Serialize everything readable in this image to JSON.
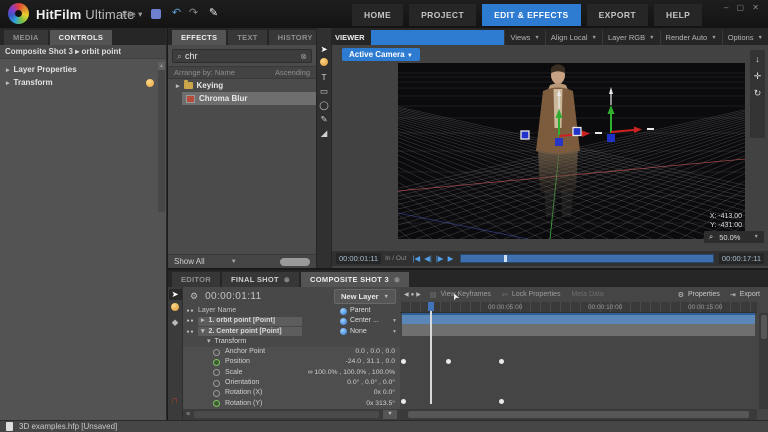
{
  "app": {
    "brand_bold": "HitFilm",
    "brand_light": "Ultimate",
    "file_menu": "File"
  },
  "main_tabs": [
    {
      "label": "HOME",
      "active": false
    },
    {
      "label": "PROJECT",
      "active": false
    },
    {
      "label": "EDIT & EFFECTS",
      "active": true
    },
    {
      "label": "EXPORT",
      "active": false
    },
    {
      "label": "HELP",
      "active": false
    }
  ],
  "left_panel": {
    "tabs": {
      "media": "MEDIA",
      "controls": "CONTROLS"
    },
    "breadcrumb": "Composite Shot 3  ▸  orbit point",
    "rows": [
      {
        "label": "Layer Properties"
      },
      {
        "label": "Transform"
      }
    ]
  },
  "effects_panel": {
    "tabs": {
      "effects": "EFFECTS",
      "text": "TEXT",
      "history": "HISTORY"
    },
    "search_value": "chr",
    "arrange_by": "Arrange by:  Name",
    "ascending": "Ascending",
    "folder": "Keying",
    "effect": "Chroma Blur",
    "show_all": "Show All"
  },
  "viewer": {
    "tab": "VIEWER",
    "menus": [
      "Views",
      "Align Local",
      "Layer RGB",
      "Render Auto",
      "Options"
    ],
    "active_camera": "Active Camera",
    "coord_x": "X:   -413.00",
    "coord_y": "Y:   -431.00",
    "zoom": "50.0%",
    "tc_current": "00:00:01:11",
    "tc_total": "00:00:17:11",
    "inout": "In / Out"
  },
  "timeline": {
    "tabs": {
      "editor": "EDITOR",
      "final_shot": "FINAL SHOT",
      "composite": "COMPOSITE SHOT 3"
    },
    "timecode": "00:00:01:11",
    "new_layer": "New Layer",
    "header_name": "Layer Name",
    "header_parent": "Parent",
    "layers": [
      {
        "name": "1. orbit point [Point]",
        "parent": "Center ..."
      },
      {
        "name": "2. Center point [Point]",
        "parent": "None"
      }
    ],
    "group": "Transform",
    "properties": [
      {
        "name": "Anchor Point",
        "value": "0.0 , 0.0 , 0.0"
      },
      {
        "name": "Position",
        "value": "-24.0 , 31.1 , 0.0"
      },
      {
        "name": "Scale",
        "value": "∞  100.0% , 100.0% , 100.0%"
      },
      {
        "name": "Orientation",
        "value": "0.0° , 0.0° , 0.0°"
      },
      {
        "name": "Rotation (X)",
        "value": "0x  0.0°"
      },
      {
        "name": "Rotation (Y)",
        "value": "0x  313.5°"
      }
    ],
    "tlr_hide": "View Keyframes",
    "tlr_lock": "Lock Properties",
    "tlr_meta": "Meta Data",
    "tlr_properties": "Properties",
    "tlr_export": "Export",
    "ruler": [
      "00:00:05:00",
      "00:00:10:00",
      "00:00:15:00"
    ]
  },
  "statusbar": {
    "file": "3D examples.hfp   [Unsaved]"
  }
}
